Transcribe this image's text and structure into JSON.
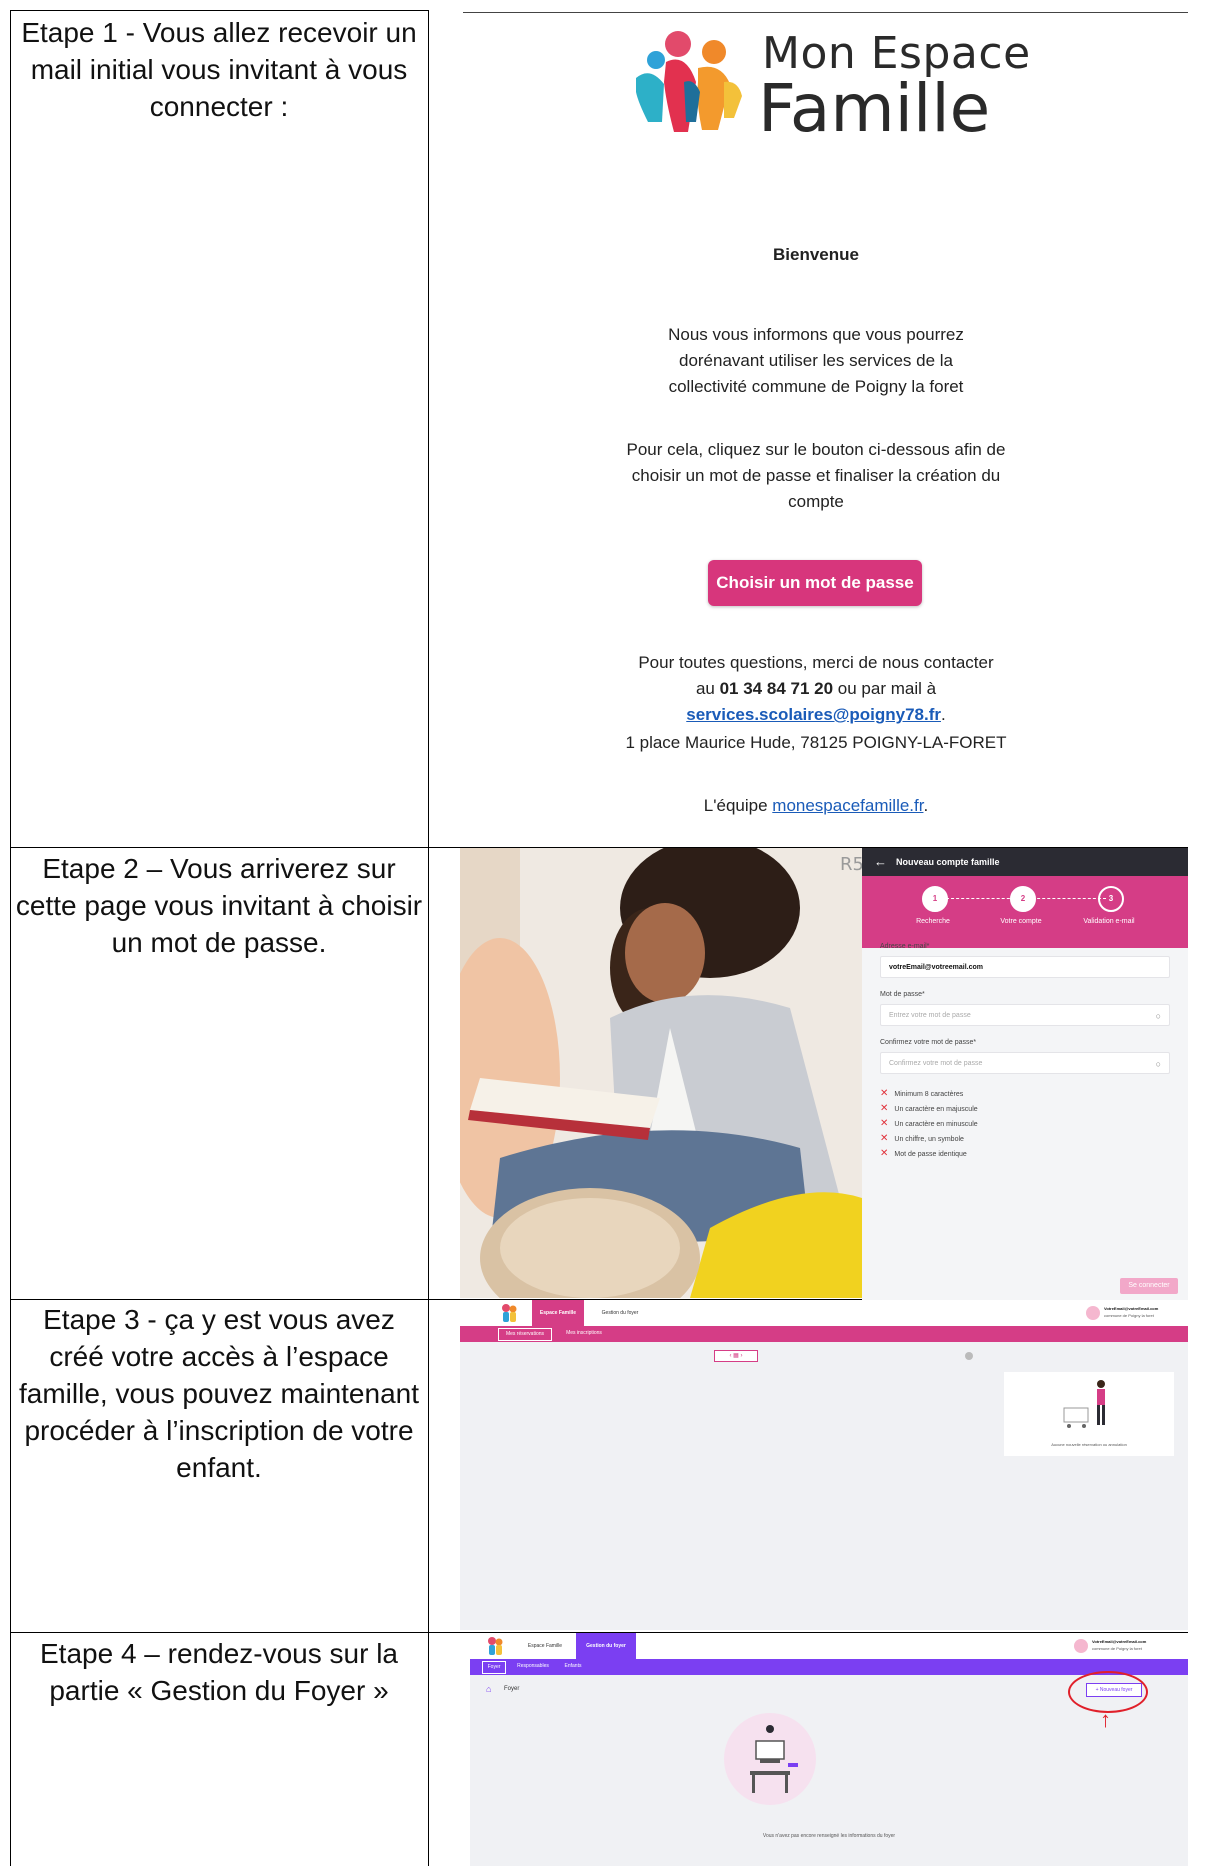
{
  "steps": [
    "Etape 1 - Vous allez recevoir un mail initial vous invitant à vous connecter :",
    "Etape 2 – Vous arriverez sur cette page vous invitant à choisir un mot de passe.",
    "Etape 3 - ça y est vous avez créé votre accès à l’espace famille, vous pouvez maintenant procéder à l’inscription de votre enfant.",
    "Etape 4 – rendez-vous sur la partie « Gestion du Foyer »"
  ],
  "email": {
    "logo_line1": "Mon Espace",
    "logo_line2": "Famille",
    "greeting": "Bienvenue",
    "para1": "Nous vous informons que vous pourrez dorénavant utiliser les services de la collectivité commune de Poigny la foret",
    "para2": "Pour cela, cliquez sur le bouton ci-dessous afin de choisir un mot de passe et finaliser la création du compte",
    "button": "Choisir un mot de passe",
    "contact_pre": "Pour toutes questions, merci de nous contacter au",
    "phone": "01 34 84 71 20",
    "contact_mid": "ou par mail à",
    "email_link": "services.scolaires@poigny78.fr",
    "address": "1 place Maurice Hude, 78125 POIGNY-LA-FORET",
    "team_pre": "L'équipe",
    "team_link": "monespacefamille.fr",
    "accent": "#d7367c"
  },
  "signup": {
    "photo_text": "R5",
    "back_icon": "arrow-left-icon",
    "header": "Nouveau compte famille",
    "steps": [
      {
        "num": "1",
        "label": "Recherche"
      },
      {
        "num": "2",
        "label": "Votre compte"
      },
      {
        "num": "3",
        "label": "Validation e-mail"
      }
    ],
    "email_label": "Adresse e-mail*",
    "email_value": "votreEmail@votreemail.com",
    "password_label": "Mot de passe*",
    "password_placeholder": "Entrez votre mot de passe",
    "confirm_label": "Confirmez votre mot de passe*",
    "confirm_placeholder": "Confirmez votre mot de passe",
    "rules": [
      "Minimum 8 caractères",
      "Un caractère en majuscule",
      "Un caractère en minuscule",
      "Un chiffre, un symbole",
      "Mot de passe identique"
    ],
    "submit": "Se connecter",
    "accent": "#d53d86"
  },
  "app3": {
    "tab_active": "Espace Famille",
    "tab_other": "Gestion du foyer",
    "subtab1": "Mes réservations",
    "subtab2": "Mes inscriptions",
    "user_email": "VotreEmail@votreEmail.com",
    "user_commune": "commune de Poigny la foret",
    "empty_text": "Aucune nouvelle réservation ou annulation"
  },
  "app4": {
    "tab1": "Espace Famille",
    "tab_active": "Gestion du foyer",
    "subtab1": "Foyer",
    "subtab2": "Responsables",
    "subtab3": "Enfants",
    "user_email": "VotreEmail@votreEmail.com",
    "user_commune": "commune de Poigny la foret",
    "section": "Foyer",
    "new_button": "+ Nouveau foyer",
    "empty_text": "Vous n'avez pas encore renseigné les informations du foyer",
    "accent": "#7b3ff2"
  }
}
